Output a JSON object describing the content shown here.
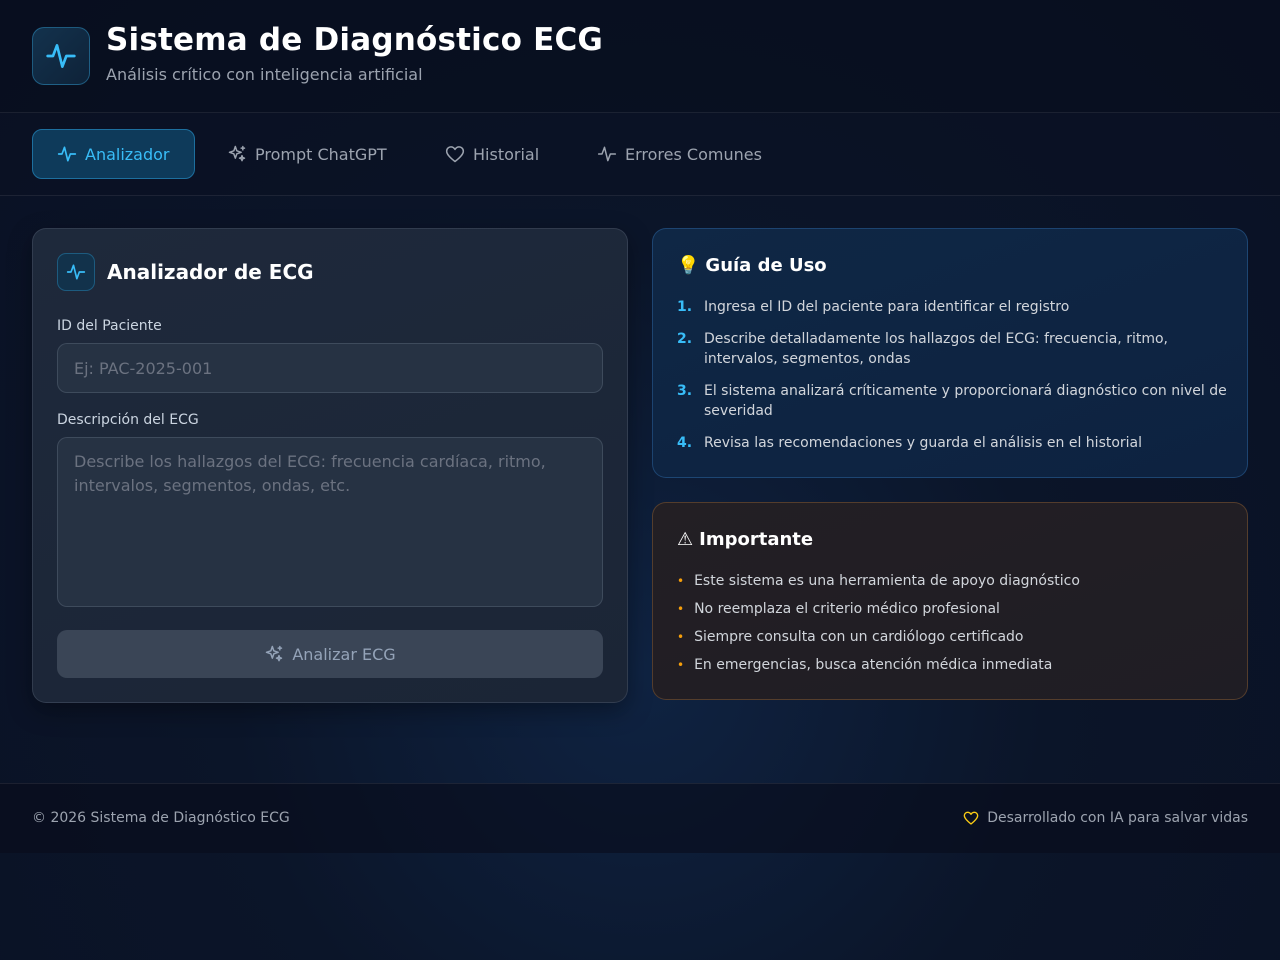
{
  "header": {
    "title": "Sistema de Diagnóstico ECG",
    "subtitle": "Análisis crítico con inteligencia artificial",
    "logo_icon": "activity-icon"
  },
  "nav": {
    "tabs": [
      {
        "label": "Analizador",
        "icon": "activity-icon",
        "active": true
      },
      {
        "label": "Prompt ChatGPT",
        "icon": "sparkles-icon",
        "active": false
      },
      {
        "label": "Historial",
        "icon": "heart-icon",
        "active": false
      },
      {
        "label": "Errores Comunes",
        "icon": "activity-icon",
        "active": false
      }
    ]
  },
  "analyzer": {
    "title": "Analizador de ECG",
    "patient_label": "ID del Paciente",
    "patient_placeholder": "Ej: PAC-2025-001",
    "ecg_label": "Descripción del ECG",
    "ecg_placeholder": "Describe los hallazgos del ECG: frecuencia cardíaca, ritmo, intervalos, segmentos, ondas, etc.",
    "submit_label": "Analizar ECG"
  },
  "guide": {
    "icon": "💡",
    "title": "Guía de Uso",
    "steps": [
      {
        "num": "1.",
        "text": "Ingresa el ID del paciente para identificar el registro"
      },
      {
        "num": "2.",
        "text": "Describe detalladamente los hallazgos del ECG: frecuencia, ritmo, intervalos, segmentos, ondas"
      },
      {
        "num": "3.",
        "text": "El sistema analizará críticamente y proporcionará diagnóstico con nivel de severidad"
      },
      {
        "num": "4.",
        "text": "Revisa las recomendaciones y guarda el análisis en el historial"
      }
    ]
  },
  "important": {
    "icon": "⚠",
    "title": "Importante",
    "items": [
      "Este sistema es una herramienta de apoyo diagnóstico",
      "No reemplaza el criterio médico profesional",
      "Siempre consulta con un cardiólogo certificado",
      "En emergencias, busca atención médica inmediata"
    ]
  },
  "footer": {
    "copyright": "© 2026 Sistema de Diagnóstico ECG",
    "tagline": "Desarrollado con IA para salvar vidas"
  },
  "colors": {
    "accent": "#38bdf8",
    "warning": "#f59e0b",
    "footer_heart": "#facc15"
  }
}
